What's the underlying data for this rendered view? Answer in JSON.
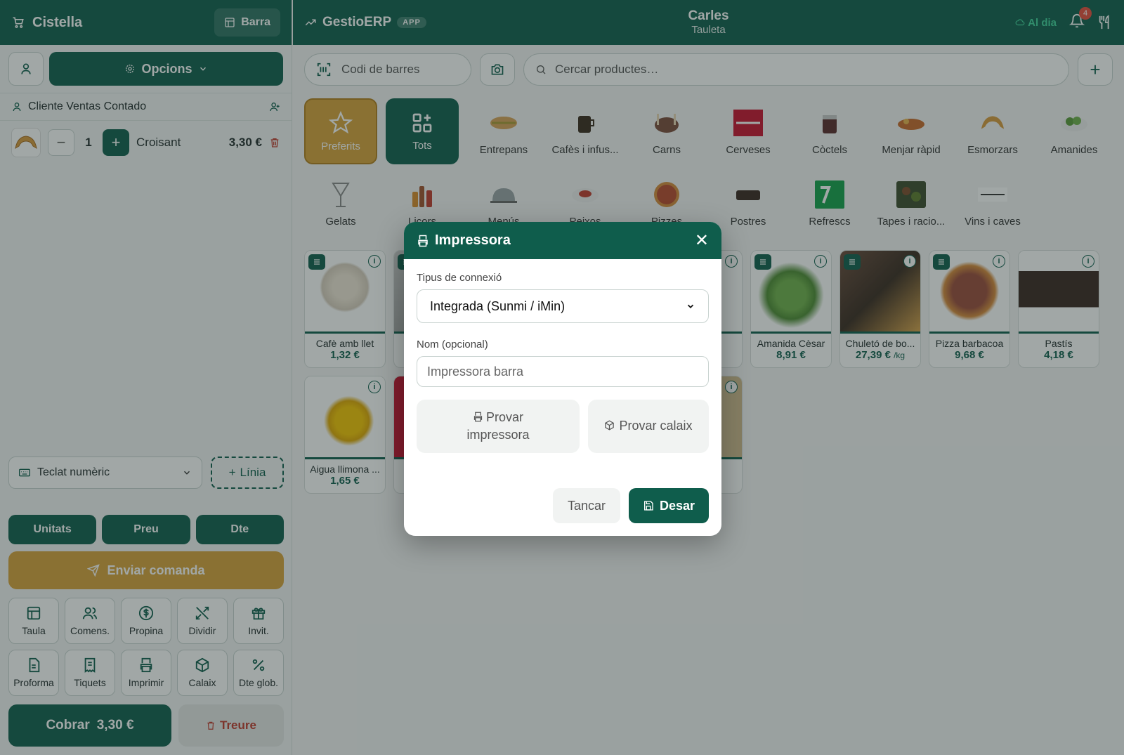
{
  "cart": {
    "title": "Cistella",
    "barra_label": "Barra",
    "opcions_label": "Opcions",
    "client_name": "Cliente Ventas Contado",
    "line": {
      "qty": "1",
      "name": "Croisant",
      "price": "3,30 €"
    },
    "keypad_label": "Teclat numèric",
    "linia_label": "Línia",
    "modes": [
      "Unitats",
      "Preu",
      "Dte"
    ],
    "send_label": "Enviar comanda",
    "tools": [
      "Taula",
      "Comens.",
      "Propina",
      "Dividir",
      "Invit.",
      "Proforma",
      "Tiquets",
      "Imprimir",
      "Calaix",
      "Dte glob."
    ],
    "pay_label": "Cobrar",
    "pay_amount": "3,30 €",
    "remove_label": "Treure"
  },
  "header": {
    "brand": "GestioERP",
    "badge": "APP",
    "user_name": "Carles",
    "user_role": "Tauleta",
    "sync_label": "Al dia",
    "notif_count": "4"
  },
  "search": {
    "barcode_placeholder": "Codi de barres",
    "product_placeholder": "Cercar productes…"
  },
  "categories": [
    "Preferits",
    "Tots",
    "Entrepans",
    "Cafès i infus...",
    "Carns",
    "Cerveses",
    "Còctels",
    "Menjar ràpid",
    "Esmorzars",
    "Amanides",
    "Gelats",
    "Licors",
    "Menús",
    "Peixos",
    "Pizzes",
    "Postres",
    "Refrescs",
    "Tapes i racio...",
    "Vins i caves"
  ],
  "products": [
    {
      "name": "Cafè amb llet",
      "price": "1,32 €"
    },
    {
      "name": "",
      "price": ""
    },
    {
      "name": "",
      "price": ""
    },
    {
      "name": "",
      "price": ""
    },
    {
      "name": "nt",
      "price": "€"
    },
    {
      "name": "Amanida Cèsar",
      "price": "8,91 €"
    },
    {
      "name": "Chuletó de bo...",
      "price": "27,39 €",
      "unit": "/kg"
    },
    {
      "name": "Pizza barbacoa",
      "price": "9,68 €"
    },
    {
      "name": "Pastís",
      "price": "4,18 €"
    },
    {
      "name": "Aigua llimona ...",
      "price": "1,65 €"
    },
    {
      "name": "",
      "price": ""
    },
    {
      "name": "",
      "price": ""
    },
    {
      "name": "",
      "price": ""
    },
    {
      "name": "nyola",
      "price": "€"
    }
  ],
  "modal": {
    "title": "Impressora",
    "connection_label": "Tipus de connexió",
    "connection_value": "Integrada (Sunmi / iMin)",
    "name_label": "Nom (opcional)",
    "name_placeholder": "Impressora barra",
    "test_printer": "Provar impressora",
    "test_drawer": "Provar calaix",
    "cancel_label": "Tancar",
    "save_label": "Desar"
  },
  "colors": {
    "primary": "#0f5d4c",
    "accent": "#d7a33a",
    "danger": "#c0392b",
    "sync": "#3ed29b"
  }
}
